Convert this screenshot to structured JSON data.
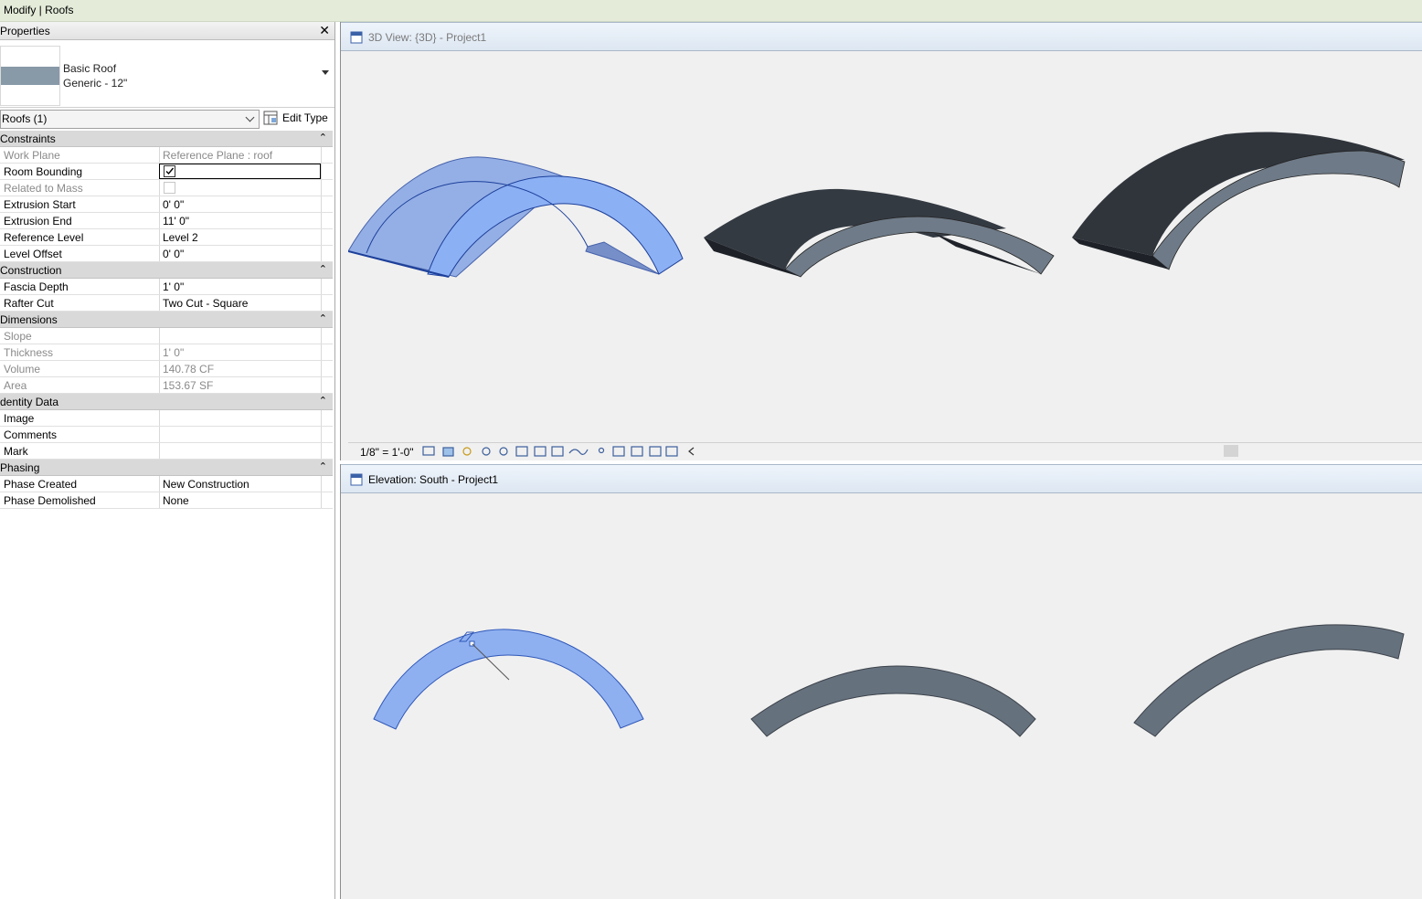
{
  "title_bar": {
    "text": "Modify | Roofs"
  },
  "properties": {
    "header": "Properties",
    "type": {
      "family": "Basic Roof",
      "name": "Generic - 12\""
    },
    "filter": "Roofs (1)",
    "edit_type_label": "Edit Type",
    "groups": [
      {
        "label": "Constraints",
        "rows": [
          {
            "name": "Work Plane",
            "value": "Reference Plane : roof",
            "disabled": true
          },
          {
            "name": "Room Bounding",
            "checkbox": true,
            "checked": true,
            "selected": true
          },
          {
            "name": "Related to Mass",
            "checkbox": true,
            "checked": false,
            "disabled": true
          },
          {
            "name": "Extrusion Start",
            "value": "0'  0\""
          },
          {
            "name": "Extrusion End",
            "value": "11'  0\""
          },
          {
            "name": "Reference Level",
            "value": "Level 2"
          },
          {
            "name": "Level Offset",
            "value": "0'  0\""
          }
        ]
      },
      {
        "label": "Construction",
        "rows": [
          {
            "name": "Fascia Depth",
            "value": "1'  0\""
          },
          {
            "name": "Rafter Cut",
            "value": "Two Cut - Square"
          }
        ]
      },
      {
        "label": "Dimensions",
        "rows": [
          {
            "name": "Slope",
            "value": "",
            "disabled": true
          },
          {
            "name": "Thickness",
            "value": "1'  0\"",
            "disabled": true
          },
          {
            "name": "Volume",
            "value": "140.78 CF",
            "disabled": true
          },
          {
            "name": "Area",
            "value": "153.67 SF",
            "disabled": true
          }
        ]
      },
      {
        "label": "dentity Data",
        "rows": [
          {
            "name": "Image",
            "value": ""
          },
          {
            "name": "Comments",
            "value": ""
          },
          {
            "name": "Mark",
            "value": ""
          }
        ]
      },
      {
        "label": "Phasing",
        "rows": [
          {
            "name": "Phase Created",
            "value": "New Construction"
          },
          {
            "name": "Phase Demolished",
            "value": "None"
          }
        ]
      }
    ]
  },
  "views": {
    "top": {
      "title": "3D View: {3D} - Project1",
      "scale": "1/8\" = 1'-0\""
    },
    "bottom": {
      "title": "Elevation: South - Project1"
    }
  },
  "colors": {
    "selected_roof": "#8fb0f0",
    "roof_light": "#66717e",
    "roof_dark": "#30353c"
  }
}
